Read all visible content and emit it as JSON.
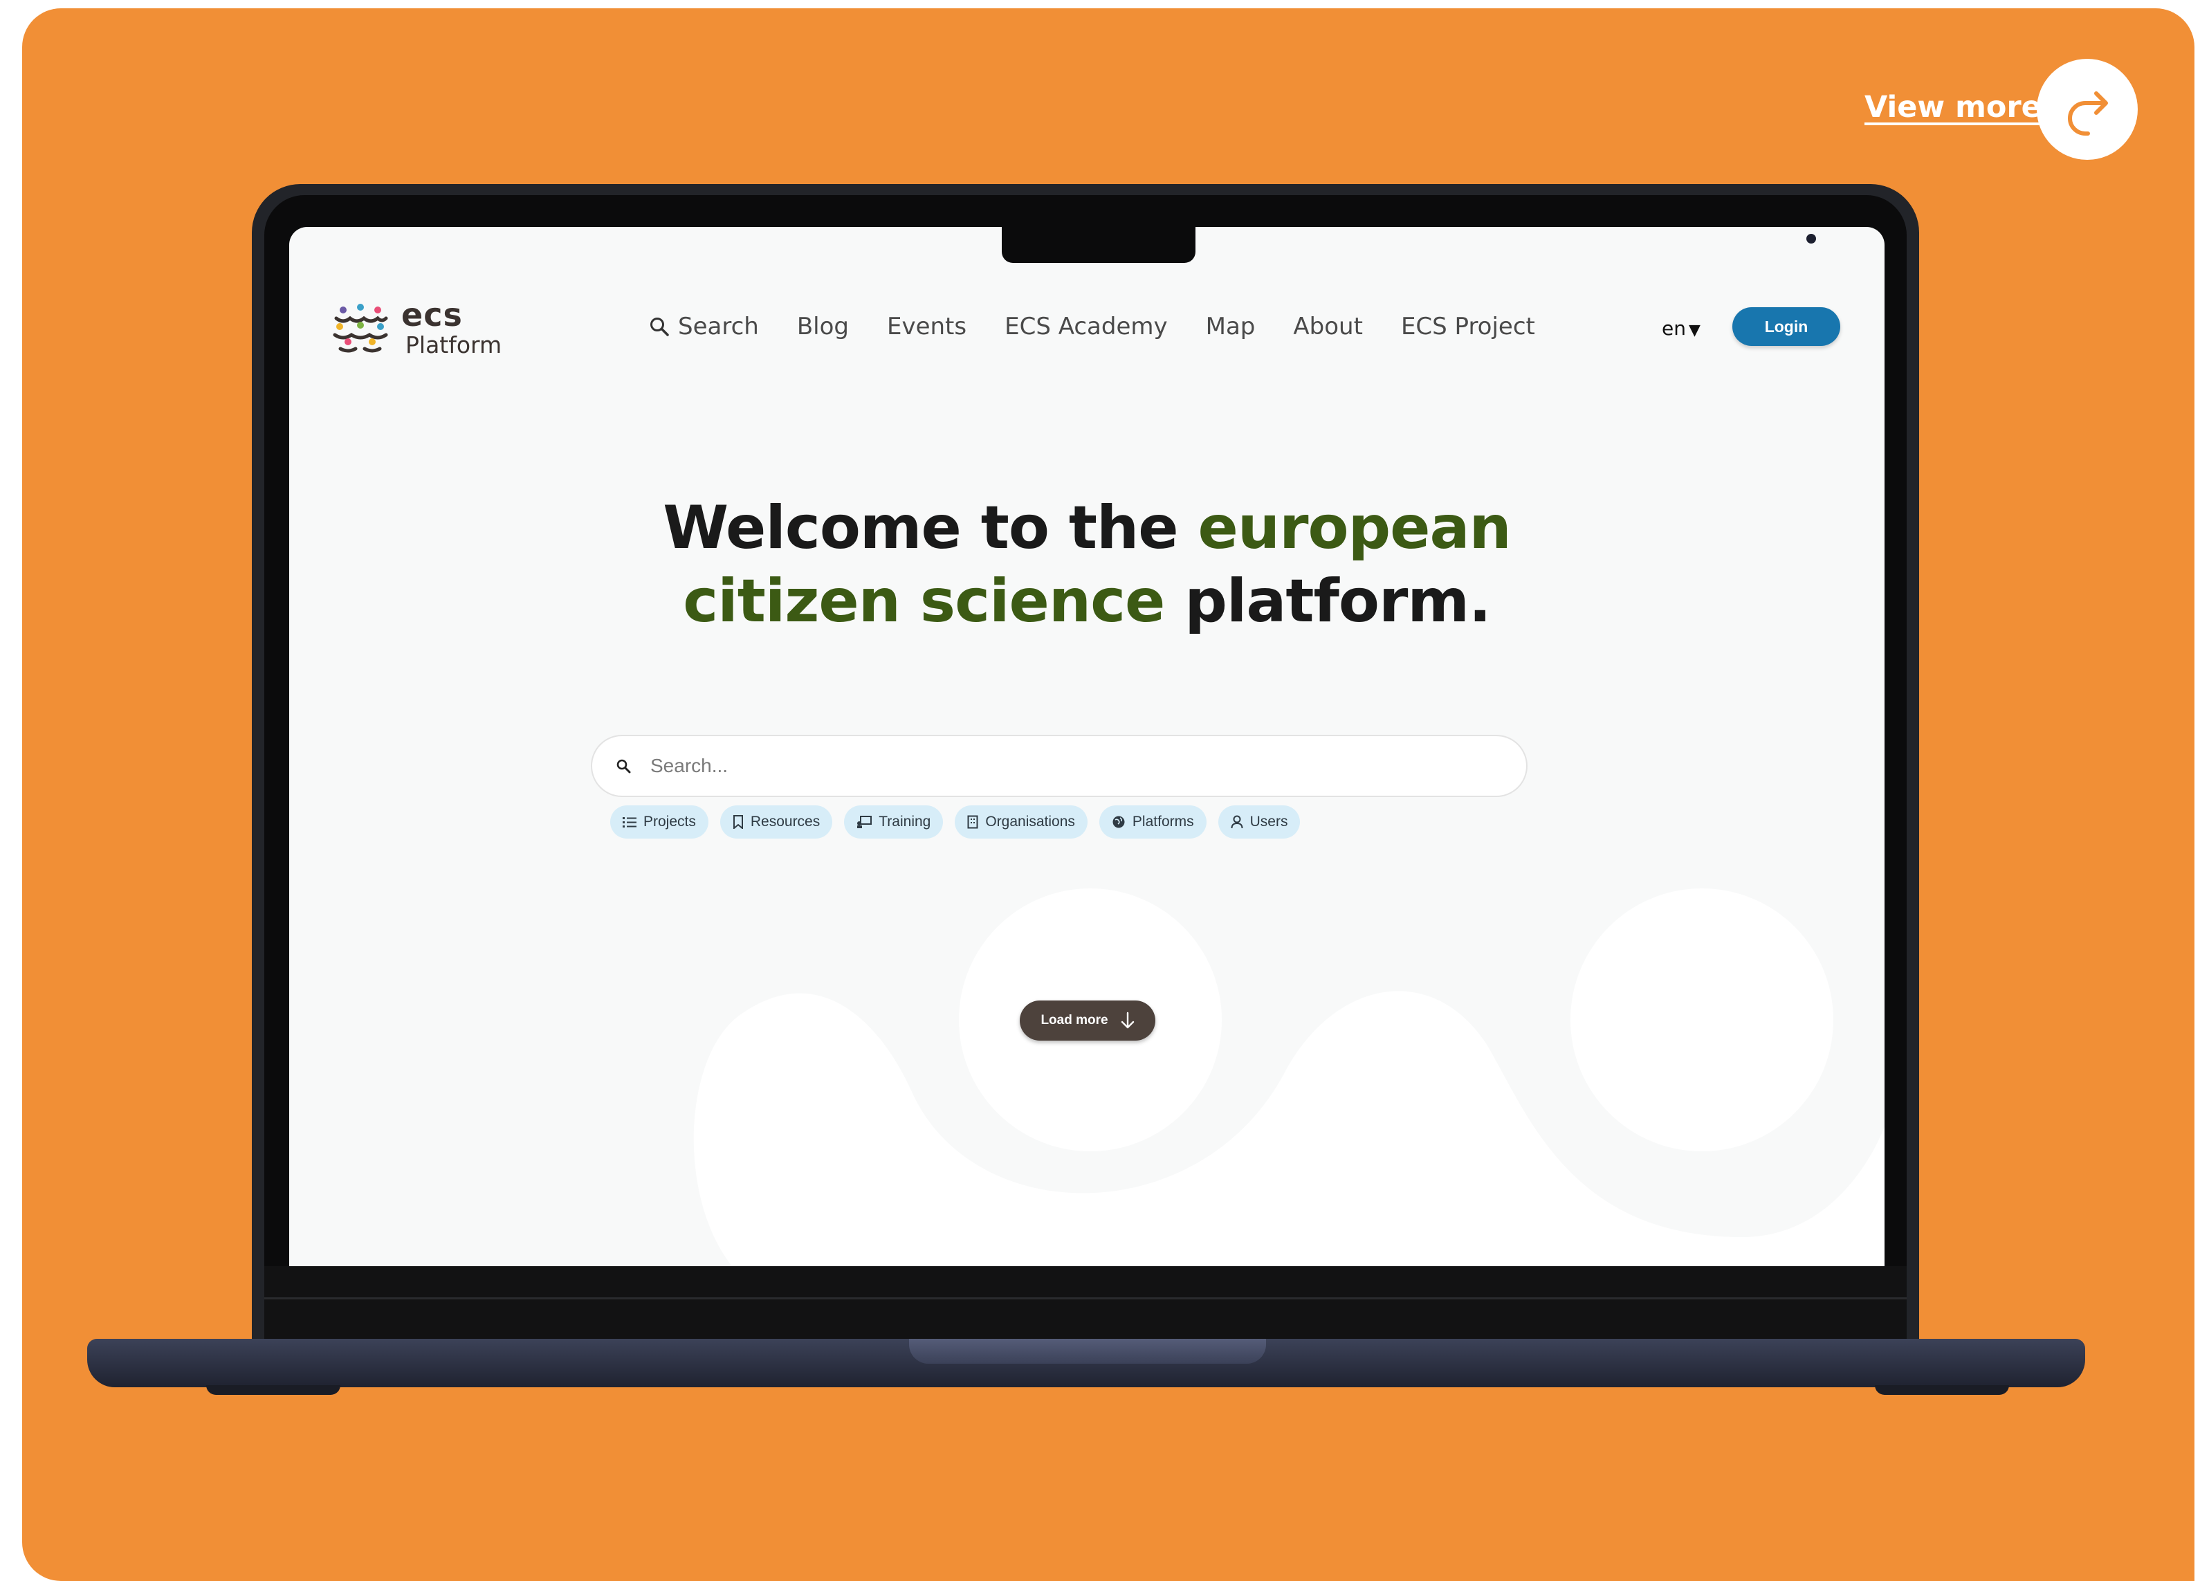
{
  "card": {
    "background": "#F18F36",
    "view_more_label": "View more",
    "view_more_icon": "share-arrow-icon"
  },
  "site": {
    "logo": {
      "name": "ecs",
      "sub": "Platform",
      "icon": "ecs-people-logo-icon"
    },
    "nav": {
      "search": "Search",
      "blog": "Blog",
      "events": "Events",
      "academy": "ECS Academy",
      "map": "Map",
      "about": "About",
      "project": "ECS Project"
    },
    "language": "en",
    "login_label": "Login",
    "accent": "#1876AE",
    "hero": {
      "part1": "Welcome to the ",
      "part2": "european",
      "part3": "citizen science",
      "part4": " platform.",
      "accent_color": "#3C5A14"
    },
    "search_placeholder": "Search...",
    "chips": {
      "projects": "Projects",
      "resources": "Resources",
      "training": "Training",
      "organisations": "Organisations",
      "platforms": "Platforms",
      "users": "Users"
    },
    "load_more": "Load more"
  }
}
